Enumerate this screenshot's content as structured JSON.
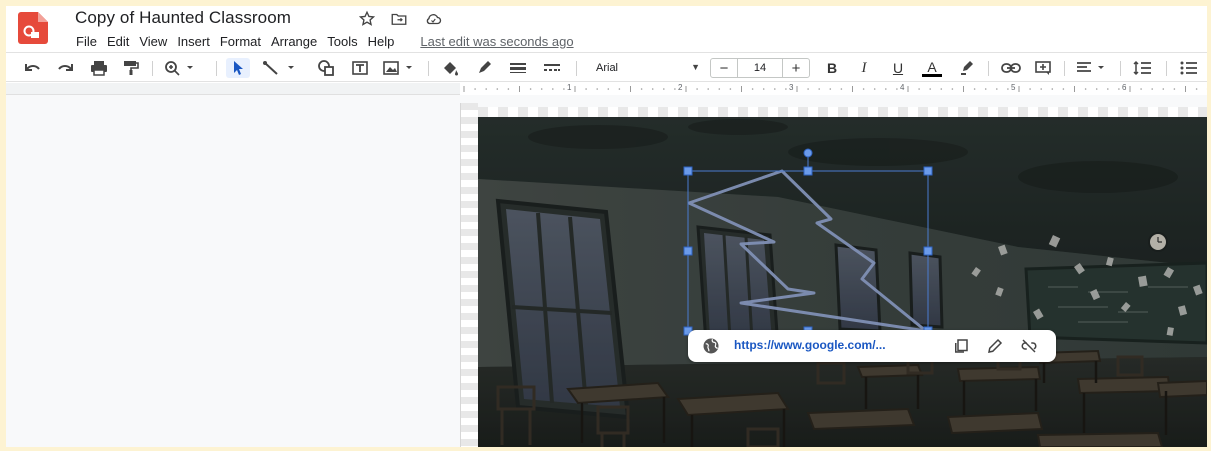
{
  "app": {
    "title": "Copy of Haunted Classroom",
    "last_edit": "Last edit was seconds ago"
  },
  "menu": [
    "File",
    "Edit",
    "View",
    "Insert",
    "Format",
    "Arrange",
    "Tools",
    "Help"
  ],
  "toolbar": {
    "font": "Arial",
    "font_size": "14",
    "decrease": "−",
    "increase": "+",
    "bold": "B",
    "italic": "I",
    "underline": "U",
    "text_color": "A",
    "text_color_value": "#000000"
  },
  "ruler": [
    "1",
    "2",
    "3",
    "4",
    "5",
    "6"
  ],
  "link_popup": {
    "url": "https://www.google.com/..."
  },
  "icons": [
    "undo-icon",
    "redo-icon",
    "print-icon",
    "paint-format-icon",
    "zoom-icon",
    "select-icon",
    "line-icon",
    "shape-icon",
    "textbox-icon",
    "image-icon",
    "fill-color-icon",
    "border-color-icon",
    "border-weight-icon",
    "border-dash-icon",
    "link-icon",
    "comment-icon",
    "align-icon",
    "line-spacing-icon",
    "list-icon",
    "star-icon",
    "move-folder-icon",
    "cloud-status-icon",
    "globe-icon",
    "copy-icon",
    "edit-icon",
    "unlink-icon"
  ]
}
